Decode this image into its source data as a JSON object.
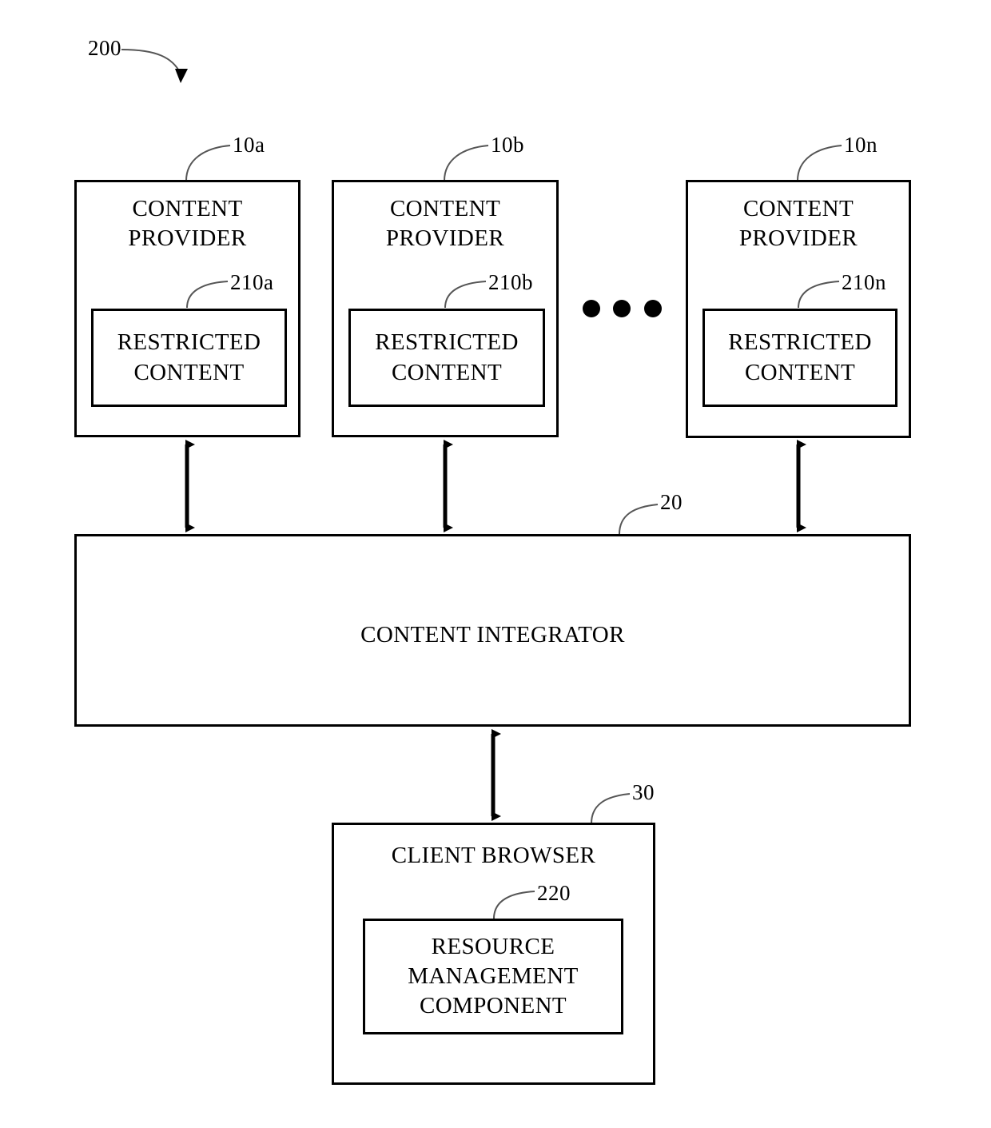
{
  "figure": {
    "figure_ref": "200",
    "providers": [
      {
        "ref": "10a",
        "title": "CONTENT\nPROVIDER",
        "inner_ref": "210a",
        "inner_title": "RESTRICTED\nCONTENT"
      },
      {
        "ref": "10b",
        "title": "CONTENT\nPROVIDER",
        "inner_ref": "210b",
        "inner_title": "RESTRICTED\nCONTENT"
      },
      {
        "ref": "10n",
        "title": "CONTENT\nPROVIDER",
        "inner_ref": "210n",
        "inner_title": "RESTRICTED\nCONTENT"
      }
    ],
    "integrator": {
      "ref": "20",
      "title": "CONTENT INTEGRATOR"
    },
    "client": {
      "ref": "30",
      "title": "CLIENT BROWSER",
      "inner_ref": "220",
      "inner_title": "RESOURCE\nMANAGEMENT\nCOMPONENT"
    },
    "ellipsis_dot_count": 3,
    "stroke_color": "#000000",
    "leader_color": "#555555",
    "background_color": "#ffffff"
  }
}
